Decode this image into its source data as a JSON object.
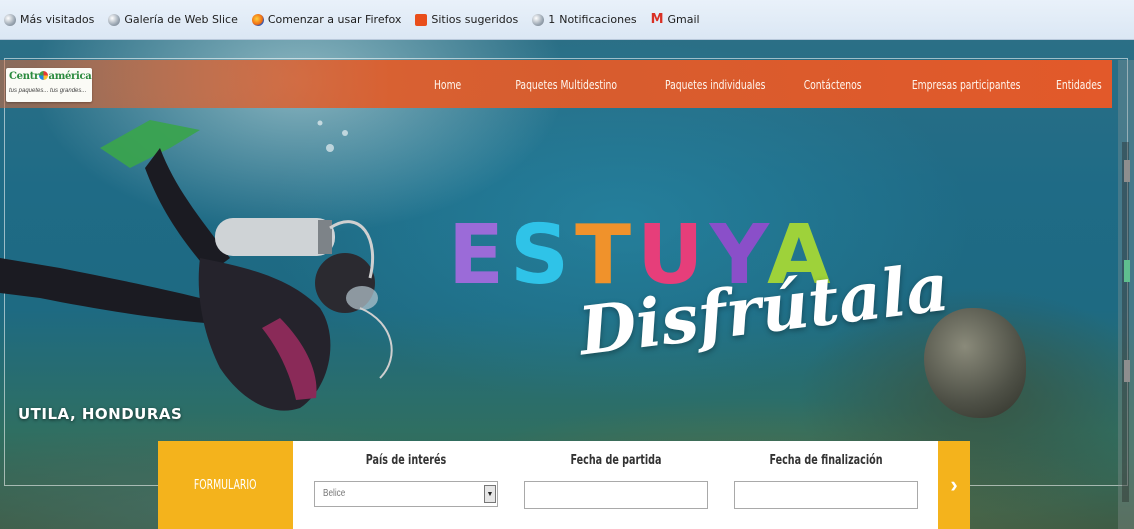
{
  "bookmarks": [
    {
      "label": "Más visitados",
      "icon": "globe-icon"
    },
    {
      "label": "Galería de Web Slice",
      "icon": "globe-icon"
    },
    {
      "label": "Comenzar a usar Firefox",
      "icon": "firefox-icon"
    },
    {
      "label": "Sitios sugeridos",
      "icon": "square-icon"
    },
    {
      "label": "1",
      "icon": "globe-icon"
    },
    {
      "label": "Notificaciones",
      "icon": "none"
    },
    {
      "label": "Gmail",
      "icon": "gmail-icon"
    }
  ],
  "logo": {
    "text": "Centro américa",
    "tagline": "tus paquetes... tus grandes..."
  },
  "nav": {
    "items": [
      "Home",
      "Paquetes Multidestino",
      "Paquetes individuales",
      "Contáctenos",
      "Empresas participantes",
      "Entidades"
    ]
  },
  "hero": {
    "headline_letters": [
      "E",
      "S",
      "T",
      "U",
      "Y",
      "A"
    ],
    "script_text": "Disfrútala",
    "location": "UTILA, HONDURAS"
  },
  "form": {
    "label": "FORMULARIO",
    "country_title": "País de interés",
    "country_value": "Belice",
    "start_title": "Fecha de partida",
    "end_title": "Fecha de finalización",
    "submit_icon": "chevron-right-icon"
  },
  "colors": {
    "nav_bg": "#e2592a",
    "form_accent": "#f4b31c"
  }
}
